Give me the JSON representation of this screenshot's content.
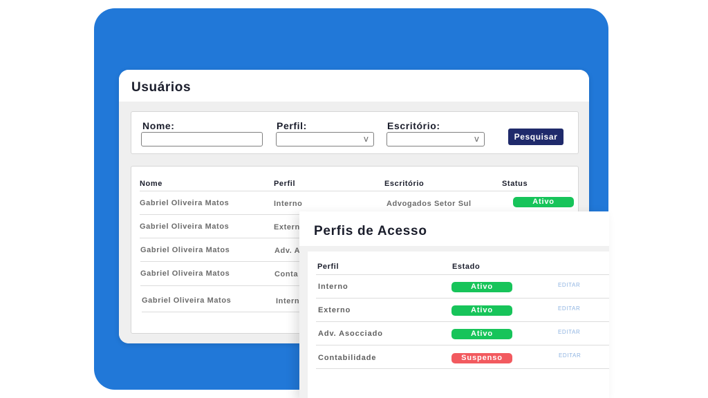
{
  "users": {
    "title": "Usuários",
    "filters": {
      "nome_label": "Nome:",
      "perfil_label": "Perfil:",
      "escritorio_label": "Escritório:",
      "chevron": "v",
      "search_button": "Pesquisar"
    },
    "table": {
      "headers": [
        "Nome",
        "Perfil",
        "Escritório",
        "Status"
      ],
      "rows": [
        {
          "nome": "Gabriel Oliveira Matos",
          "perfil": "Interno",
          "escritorio": "Advogados Setor Sul",
          "status": "Ativo"
        },
        {
          "nome": "Gabriel Oliveira Matos",
          "perfil": "Extern"
        },
        {
          "nome": "Gabriel Oliveira Matos",
          "perfil": "Adv. A"
        },
        {
          "nome": "Gabriel Oliveira Matos",
          "perfil": "Conta"
        },
        {
          "nome": "Gabriel Oliveira Matos",
          "perfil": "Intern"
        }
      ]
    }
  },
  "perfis": {
    "title": "Perfis de Acesso",
    "headers": [
      "Perfil",
      "Estado"
    ],
    "edit_label": "EDITAR",
    "rows": [
      {
        "perfil": "Interno",
        "estado": "Ativo",
        "estado_color": "#17c45a"
      },
      {
        "perfil": "Externo",
        "estado": "Ativo",
        "estado_color": "#17c45a"
      },
      {
        "perfil": "Adv. Asocciado",
        "estado": "Ativo",
        "estado_color": "#17c45a"
      },
      {
        "perfil": "Contabilidade",
        "estado": "Suspenso",
        "estado_color": "#f25a5f"
      }
    ]
  },
  "colors": {
    "background_blue": "#2178d8",
    "button_navy": "#1f2a6b",
    "status_active": "#17c45a",
    "status_suspended": "#f25a5f",
    "edit_link": "#8fb4e2"
  }
}
